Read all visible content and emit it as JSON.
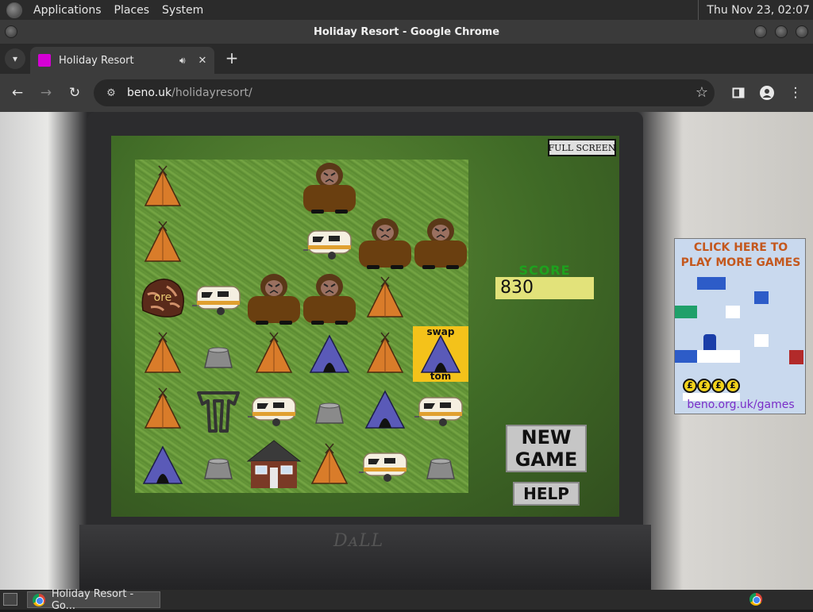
{
  "os_panel": {
    "menus": [
      "Applications",
      "Places",
      "System"
    ],
    "clock": "Thu Nov 23, 02:07"
  },
  "window": {
    "title": "Holiday Resort - Google Chrome"
  },
  "tab": {
    "title": "Holiday Resort"
  },
  "address": {
    "domain": "beno.uk",
    "path": "/holidayresort/"
  },
  "game": {
    "fullscreen_label": "FULL SCREEN",
    "score_label": "SCORE",
    "score_value": "830",
    "new_game_label": "NEW GAME",
    "help_label": "HELP",
    "swap_top_label": "swap",
    "swap_bottom_label": "tom",
    "ore_label": "ore",
    "selected_tile": {
      "row": 3,
      "col": 5
    },
    "board": [
      [
        "tent-orange",
        "empty",
        "empty",
        "bigfoot",
        "empty",
        "empty"
      ],
      [
        "tent-orange",
        "empty",
        "empty",
        "caravan",
        "bigfoot",
        "bigfoot"
      ],
      [
        "rock-ore",
        "caravan",
        "bigfoot",
        "bigfoot",
        "tent-orange",
        "empty"
      ],
      [
        "tent-orange",
        "stump",
        "tent-orange",
        "tent-blue",
        "tent-orange",
        "tent-blue"
      ],
      [
        "tent-orange",
        "frame",
        "caravan",
        "stump",
        "tent-blue",
        "caravan"
      ],
      [
        "tent-blue",
        "stump",
        "house",
        "tent-orange",
        "caravan",
        "stump"
      ]
    ]
  },
  "ad": {
    "title_line1": "CLICK HERE TO",
    "title_line2": "PLAY MORE GAMES",
    "coin_symbol": "£",
    "link": "beno.org.uk/games"
  },
  "taskbar": {
    "task_label": "Holiday Resort - Go..."
  },
  "colors": {
    "score_green": "#1ea11e",
    "score_box": "#e2e27a",
    "selected": "#f4c21a",
    "favicon": "#d400d4"
  }
}
